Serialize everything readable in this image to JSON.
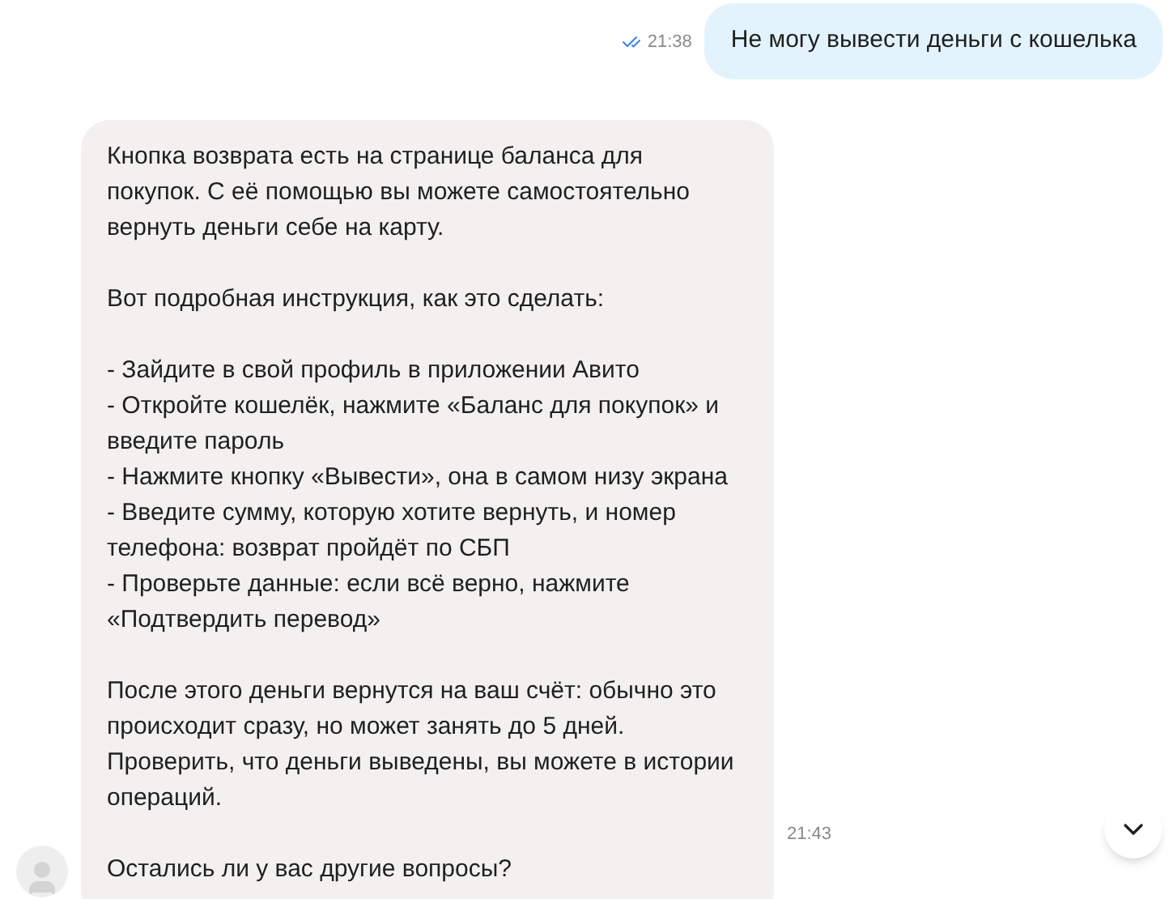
{
  "outgoing": {
    "time": "21:38",
    "read": true,
    "text": "Не могу вывести деньги с кошелька"
  },
  "incoming": {
    "time": "21:43",
    "blocks": [
      {
        "kind": "paragraph",
        "text": "Кнопка возврата есть на странице баланса для покупок. С её помощью вы можете самостоятельно вернуть деньги себе на карту."
      },
      {
        "kind": "paragraph",
        "text": "Вот подробная инструкция, как это сделать:"
      },
      {
        "kind": "list",
        "items": [
          "- Зайдите в свой профиль в приложении Авито",
          "- Откройте кошелёк, нажмите «Баланс для покупок» и введите пароль",
          "- Нажмите кнопку «Вывести», она в самом низу экрана",
          "- Введите сумму, которую хотите вернуть, и номер телефона: возврат пройдёт по СБП",
          "- Проверьте данные: если всё верно, нажмите «Подтвердить перевод»"
        ]
      },
      {
        "kind": "paragraph",
        "text": "После этого деньги вернутся на ваш счёт: обычно это происходит сразу, но может занять до 5 дней. Проверить, что деньги выведены, вы можете в истории операций."
      },
      {
        "kind": "paragraph",
        "text": "Остались ли у вас другие вопросы?"
      }
    ]
  }
}
